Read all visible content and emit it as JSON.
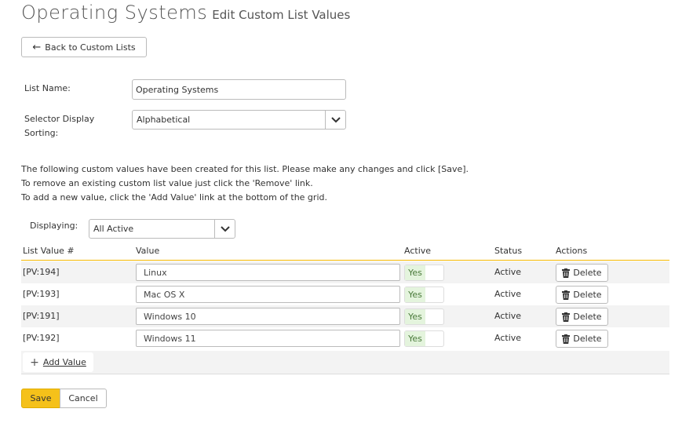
{
  "page": {
    "title": "Operating Systems",
    "subtitle": "Edit Custom List Values",
    "back_label": "Back to Custom Lists"
  },
  "form": {
    "list_name_label": "List Name:",
    "list_name_value": "Operating Systems",
    "sorting_label_line1": "Selector Display",
    "sorting_label_line2": "Sorting:",
    "sorting_value": "Alphabetical"
  },
  "instructions": [
    "The following custom values have been created for this list. Please make any changes and click [Save].",
    "To remove an existing custom list value just click the 'Remove' link.",
    "To add a new value, click the 'Add Value' link at the bottom of the grid."
  ],
  "filter": {
    "label": "Displaying:",
    "value": "All Active"
  },
  "grid": {
    "columns": [
      "List Value #",
      "Value",
      "Active",
      "Status",
      "Actions"
    ],
    "rows": [
      {
        "id": "[PV:194]",
        "value": "Linux",
        "active": "Yes",
        "status": "Active",
        "action": "Delete"
      },
      {
        "id": "[PV:193]",
        "value": "Mac OS X",
        "active": "Yes",
        "status": "Active",
        "action": "Delete"
      },
      {
        "id": "[PV:191]",
        "value": "Windows 10",
        "active": "Yes",
        "status": "Active",
        "action": "Delete"
      },
      {
        "id": "[PV:192]",
        "value": "Windows 11",
        "active": "Yes",
        "status": "Active",
        "action": "Delete"
      }
    ],
    "add_label": "Add Value"
  },
  "footer": {
    "save_label": "Save",
    "cancel_label": "Cancel"
  },
  "colors": {
    "accent": "#f5c11a",
    "header_underline": "#f5b800",
    "active_toggle": "#e4f4dd"
  }
}
